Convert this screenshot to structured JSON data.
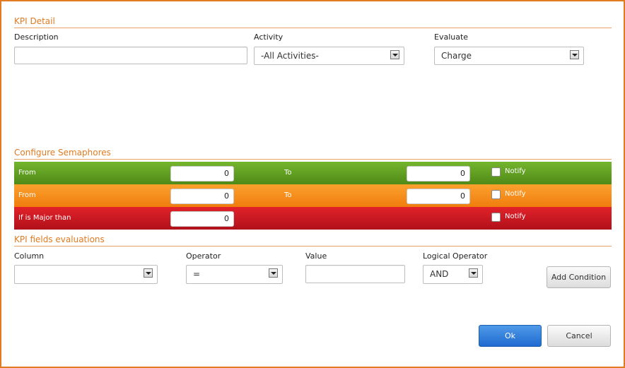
{
  "kpi_detail": {
    "title": "KPI Detail",
    "description_label": "Description",
    "description_value": "",
    "activity_label": "Activity",
    "activity_value": "-All Activities-",
    "evaluate_label": "Evaluate",
    "evaluate_value": "Charge"
  },
  "semaphores": {
    "title": "Configure Semaphores",
    "rows": [
      {
        "from_label": "From",
        "from_value": "0",
        "to_label": "To",
        "to_value": "0",
        "notify_label": "Notify",
        "color": "#5e9d22"
      },
      {
        "from_label": "From",
        "from_value": "0",
        "to_label": "To",
        "to_value": "0",
        "notify_label": "Notify",
        "color": "#f58d1a"
      },
      {
        "from_label": "If is Major than",
        "from_value": "0",
        "notify_label": "Notify",
        "color": "#c81820"
      }
    ]
  },
  "fields": {
    "title": "KPI fields evaluations",
    "column_label": "Column",
    "column_value": "",
    "operator_label": "Operator",
    "operator_value": "=",
    "value_label": "Value",
    "value_value": "",
    "logical_label": "Logical Operator",
    "logical_value": "AND",
    "add_condition": "Add Condition"
  },
  "footer": {
    "ok": "Ok",
    "cancel": "Cancel"
  },
  "colors": {
    "accent": "#e07b22",
    "primary_button": "#2f7ad9"
  }
}
